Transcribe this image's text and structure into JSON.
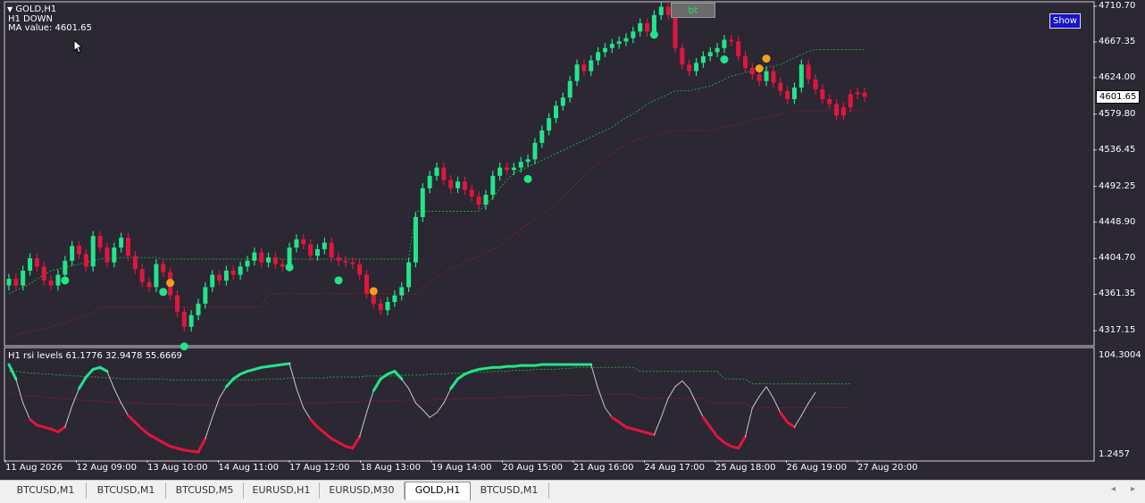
{
  "header": {
    "symbol_line": "GOLD,H1",
    "trend_line": "H1  DOWN",
    "ma_line": "MA value: 4601.65"
  },
  "buttons": {
    "bt_label": "bt",
    "show_label": "Show"
  },
  "indicator": {
    "label": "H1  rsi levels  61.1776 32.9478 55.6669"
  },
  "colors": {
    "background": "#2b2733",
    "bull": "#22e58a",
    "bear": "#e0163e",
    "neutral": "#c8c8c8",
    "upper_band": "#1fa83a",
    "lower_band": "#8a1f2a"
  },
  "chart_data": [
    {
      "type": "candlestick",
      "title": "GOLD,H1",
      "ylim": [
        4300,
        4715
      ],
      "y_ticks": [
        "4710.70",
        "4667.35",
        "4624.00",
        "4579.80",
        "4536.45",
        "4492.25",
        "4448.90",
        "4404.70",
        "4361.35",
        "4317.15"
      ],
      "current_price_label": "4601.65",
      "x_ticks": [
        "11 Aug 2026",
        "12 Aug 09:00",
        "13 Aug 10:00",
        "14 Aug 11:00",
        "17 Aug 12:00",
        "18 Aug 13:00",
        "19 Aug 14:00",
        "20 Aug 15:00",
        "21 Aug 16:00",
        "24 Aug 17:00",
        "25 Aug 18:00",
        "26 Aug 19:00",
        "27 Aug 20:00"
      ],
      "close_series": [
        4380,
        4372,
        4390,
        4405,
        4395,
        4378,
        4372,
        4385,
        4402,
        4420,
        4410,
        4395,
        4432,
        4418,
        4400,
        4418,
        4430,
        4408,
        4392,
        4376,
        4370,
        4398,
        4388,
        4360,
        4340,
        4322,
        4336,
        4350,
        4370,
        4385,
        4378,
        4390,
        4385,
        4395,
        4402,
        4412,
        4400,
        4406,
        4398,
        4395,
        4418,
        4428,
        4422,
        4408,
        4416,
        4424,
        4406,
        4402,
        4400,
        4398,
        4385,
        4362,
        4350,
        4342,
        4352,
        4360,
        4370,
        4400,
        4455,
        4490,
        4505,
        4515,
        4500,
        4490,
        4498,
        4488,
        4480,
        4470,
        4482,
        4505,
        4515,
        4512,
        4515,
        4522,
        4525,
        4545,
        4560,
        4575,
        4590,
        4600,
        4620,
        4640,
        4632,
        4645,
        4655,
        4660,
        4665,
        4668,
        4672,
        4680,
        4690,
        4680,
        4700,
        4710,
        4700,
        4660,
        4640,
        4632,
        4642,
        4650,
        4655,
        4660,
        4670,
        4668,
        4650,
        4636,
        4628,
        4620,
        4632,
        4618,
        4608,
        4598,
        4612,
        4640,
        4622,
        4610,
        4598,
        4592,
        4578,
        4588,
        4604,
        4606,
        4601
      ],
      "open_series": [
        4372,
        4380,
        4372,
        4390,
        4405,
        4395,
        4378,
        4372,
        4385,
        4402,
        4420,
        4410,
        4395,
        4432,
        4418,
        4400,
        4418,
        4430,
        4408,
        4392,
        4376,
        4370,
        4398,
        4388,
        4360,
        4340,
        4322,
        4336,
        4350,
        4370,
        4385,
        4378,
        4390,
        4385,
        4395,
        4402,
        4412,
        4400,
        4406,
        4398,
        4395,
        4418,
        4428,
        4422,
        4408,
        4416,
        4424,
        4406,
        4402,
        4400,
        4398,
        4385,
        4362,
        4350,
        4342,
        4352,
        4360,
        4370,
        4400,
        4455,
        4490,
        4505,
        4515,
        4500,
        4490,
        4498,
        4488,
        4480,
        4470,
        4482,
        4505,
        4515,
        4512,
        4515,
        4522,
        4525,
        4545,
        4560,
        4575,
        4590,
        4600,
        4620,
        4640,
        4632,
        4645,
        4655,
        4660,
        4665,
        4668,
        4672,
        4680,
        4690,
        4680,
        4700,
        4710,
        4700,
        4660,
        4640,
        4632,
        4642,
        4650,
        4655,
        4660,
        4670,
        4668,
        4650,
        4636,
        4628,
        4620,
        4632,
        4618,
        4608,
        4598,
        4612,
        4640,
        4622,
        4610,
        4598,
        4592,
        4578,
        4588,
        4604,
        4606
      ],
      "upper_band": [
        4362,
        4366,
        4370,
        4374,
        4380,
        4385,
        4390,
        4392,
        4394,
        4396,
        4398,
        4400,
        4402,
        4404,
        4405,
        4405,
        4406,
        4406,
        4406,
        4406,
        4406,
        4406,
        4404,
        4404,
        4404,
        4404,
        4404,
        4404,
        4404,
        4404,
        4404,
        4404,
        4404,
        4404,
        4404,
        4404,
        4404,
        4404,
        4404,
        4404,
        4404,
        4404,
        4404,
        4404,
        4404,
        4404,
        4404,
        4404,
        4404,
        4404,
        4404,
        4404,
        4404,
        4404,
        4404,
        4404,
        4404,
        4404,
        4462,
        4462,
        4462,
        4462,
        4462,
        4462,
        4462,
        4462,
        4462,
        4462,
        4470,
        4478,
        4490,
        4500,
        4508,
        4512,
        4516,
        4520,
        4524,
        4528,
        4532,
        4536,
        4540,
        4544,
        4548,
        4552,
        4556,
        4560,
        4564,
        4570,
        4576,
        4580,
        4586,
        4592,
        4596,
        4600,
        4604,
        4608,
        4608,
        4608,
        4610,
        4612,
        4614,
        4618,
        4622,
        4626,
        4628,
        4630,
        4632,
        4634,
        4636,
        4638,
        4640,
        4644,
        4648,
        4652,
        4656,
        4658,
        4658,
        4658,
        4658,
        4658,
        4658,
        4658,
        4658
      ],
      "lower_band": [
        4310,
        4312,
        4314,
        4316,
        4318,
        4320,
        4322,
        4324,
        4326,
        4330,
        4334,
        4336,
        4340,
        4344,
        4346,
        4346,
        4346,
        4346,
        4346,
        4346,
        4346,
        4346,
        4346,
        4346,
        4346,
        4346,
        4346,
        4346,
        4346,
        4346,
        4346,
        4346,
        4346,
        4346,
        4346,
        4346,
        4346,
        4362,
        4362,
        4362,
        4362,
        4362,
        4362,
        4362,
        4362,
        4362,
        4362,
        4362,
        4362,
        4362,
        4362,
        4362,
        4362,
        4362,
        4362,
        4362,
        4362,
        4362,
        4362,
        4370,
        4376,
        4382,
        4388,
        4392,
        4396,
        4400,
        4404,
        4408,
        4412,
        4416,
        4420,
        4428,
        4434,
        4440,
        4446,
        4452,
        4458,
        4464,
        4472,
        4480,
        4488,
        4496,
        4504,
        4512,
        4520,
        4526,
        4532,
        4538,
        4542,
        4546,
        4550,
        4552,
        4554,
        4556,
        4558,
        4560,
        4560,
        4560,
        4560,
        4560,
        4560,
        4562,
        4564,
        4566,
        4568,
        4570,
        4572,
        4574,
        4576,
        4578,
        4580,
        4582,
        4584,
        4584,
        4584,
        4584,
        4584,
        4584,
        4584,
        4584,
        4584,
        4584,
        4584
      ],
      "buy_signal_x": [
        8,
        22,
        25,
        40,
        47,
        74,
        92,
        102
      ],
      "sell_signal_x": [
        23,
        52,
        107,
        108
      ]
    },
    {
      "type": "line",
      "title": "H1  rsi levels  61.1776 32.9478 55.6669",
      "ylim": [
        1.2457,
        104.3004
      ],
      "y_ticks": [
        "104.3004",
        "1.2457"
      ],
      "rsi": [
        95,
        80,
        55,
        38,
        32,
        30,
        28,
        25,
        30,
        52,
        70,
        82,
        90,
        92,
        88,
        70,
        55,
        42,
        35,
        28,
        22,
        18,
        14,
        10,
        8,
        6,
        5,
        4,
        18,
        40,
        60,
        72,
        80,
        85,
        88,
        90,
        92,
        93,
        94,
        95,
        96,
        70,
        50,
        38,
        30,
        24,
        18,
        14,
        10,
        8,
        20,
        45,
        68,
        80,
        85,
        88,
        80,
        70,
        55,
        48,
        40,
        45,
        55,
        70,
        80,
        85,
        88,
        90,
        91,
        92,
        92,
        93,
        93,
        94,
        94,
        94,
        95,
        95,
        95,
        95,
        95,
        95,
        95,
        95,
        70,
        50,
        40,
        35,
        30,
        28,
        26,
        24,
        22,
        40,
        60,
        72,
        78,
        70,
        55,
        40,
        30,
        20,
        14,
        10,
        8,
        20,
        50,
        62,
        72,
        60,
        45,
        35,
        30,
        42,
        55,
        66
      ],
      "upper_level": [
        88,
        88,
        87,
        86,
        86,
        85,
        85,
        84,
        84,
        83,
        83,
        82,
        82,
        82,
        81,
        81,
        80,
        80,
        80,
        80,
        80,
        80,
        80,
        79,
        79,
        79,
        79,
        79,
        79,
        79,
        79,
        79,
        79,
        79,
        79,
        79,
        80,
        80,
        80,
        80,
        81,
        81,
        81,
        81,
        81,
        81,
        82,
        82,
        82,
        82,
        82,
        83,
        83,
        83,
        83,
        83,
        84,
        84,
        84,
        84,
        85,
        85,
        85,
        86,
        86,
        86,
        87,
        87,
        87,
        88,
        88,
        88,
        89,
        89,
        89,
        90,
        90,
        90,
        90,
        91,
        91,
        92,
        92,
        92,
        92,
        92,
        92,
        92,
        92,
        92,
        88,
        88,
        88,
        88,
        88,
        88,
        88,
        88,
        88,
        88,
        88,
        88,
        80,
        80,
        80,
        80,
        75,
        75,
        75,
        75,
        75,
        75,
        75,
        75,
        75,
        75,
        75,
        75,
        75,
        75,
        75
      ],
      "lower_level": [
        65,
        64,
        63,
        62,
        62,
        61,
        60,
        60,
        59,
        59,
        58,
        58,
        57,
        57,
        56,
        56,
        55,
        55,
        55,
        55,
        54,
        54,
        54,
        54,
        53,
        53,
        53,
        53,
        53,
        53,
        53,
        53,
        53,
        53,
        53,
        53,
        54,
        54,
        54,
        54,
        54,
        55,
        55,
        55,
        55,
        55,
        56,
        56,
        56,
        56,
        56,
        57,
        57,
        57,
        57,
        57,
        58,
        58,
        58,
        58,
        58,
        59,
        59,
        59,
        59,
        60,
        60,
        60,
        60,
        60,
        61,
        61,
        61,
        61,
        62,
        62,
        62,
        62,
        62,
        63,
        63,
        63,
        63,
        63,
        64,
        64,
        64,
        64,
        64,
        64,
        60,
        60,
        60,
        60,
        60,
        60,
        60,
        60,
        60,
        60,
        55,
        55,
        55,
        55,
        55,
        55,
        50,
        50,
        50,
        50,
        50,
        50,
        50,
        50,
        50,
        50,
        50,
        50,
        50,
        50,
        50
      ]
    }
  ],
  "tabs": [
    {
      "label": "BTCUSD,M1"
    },
    {
      "label": "BTCUSD,M1"
    },
    {
      "label": "BTCUSD,M5"
    },
    {
      "label": "EURUSD,H1"
    },
    {
      "label": "EURUSD,M30"
    },
    {
      "label": "GOLD,H1",
      "active": true
    },
    {
      "label": "BTCUSD,M1"
    }
  ]
}
